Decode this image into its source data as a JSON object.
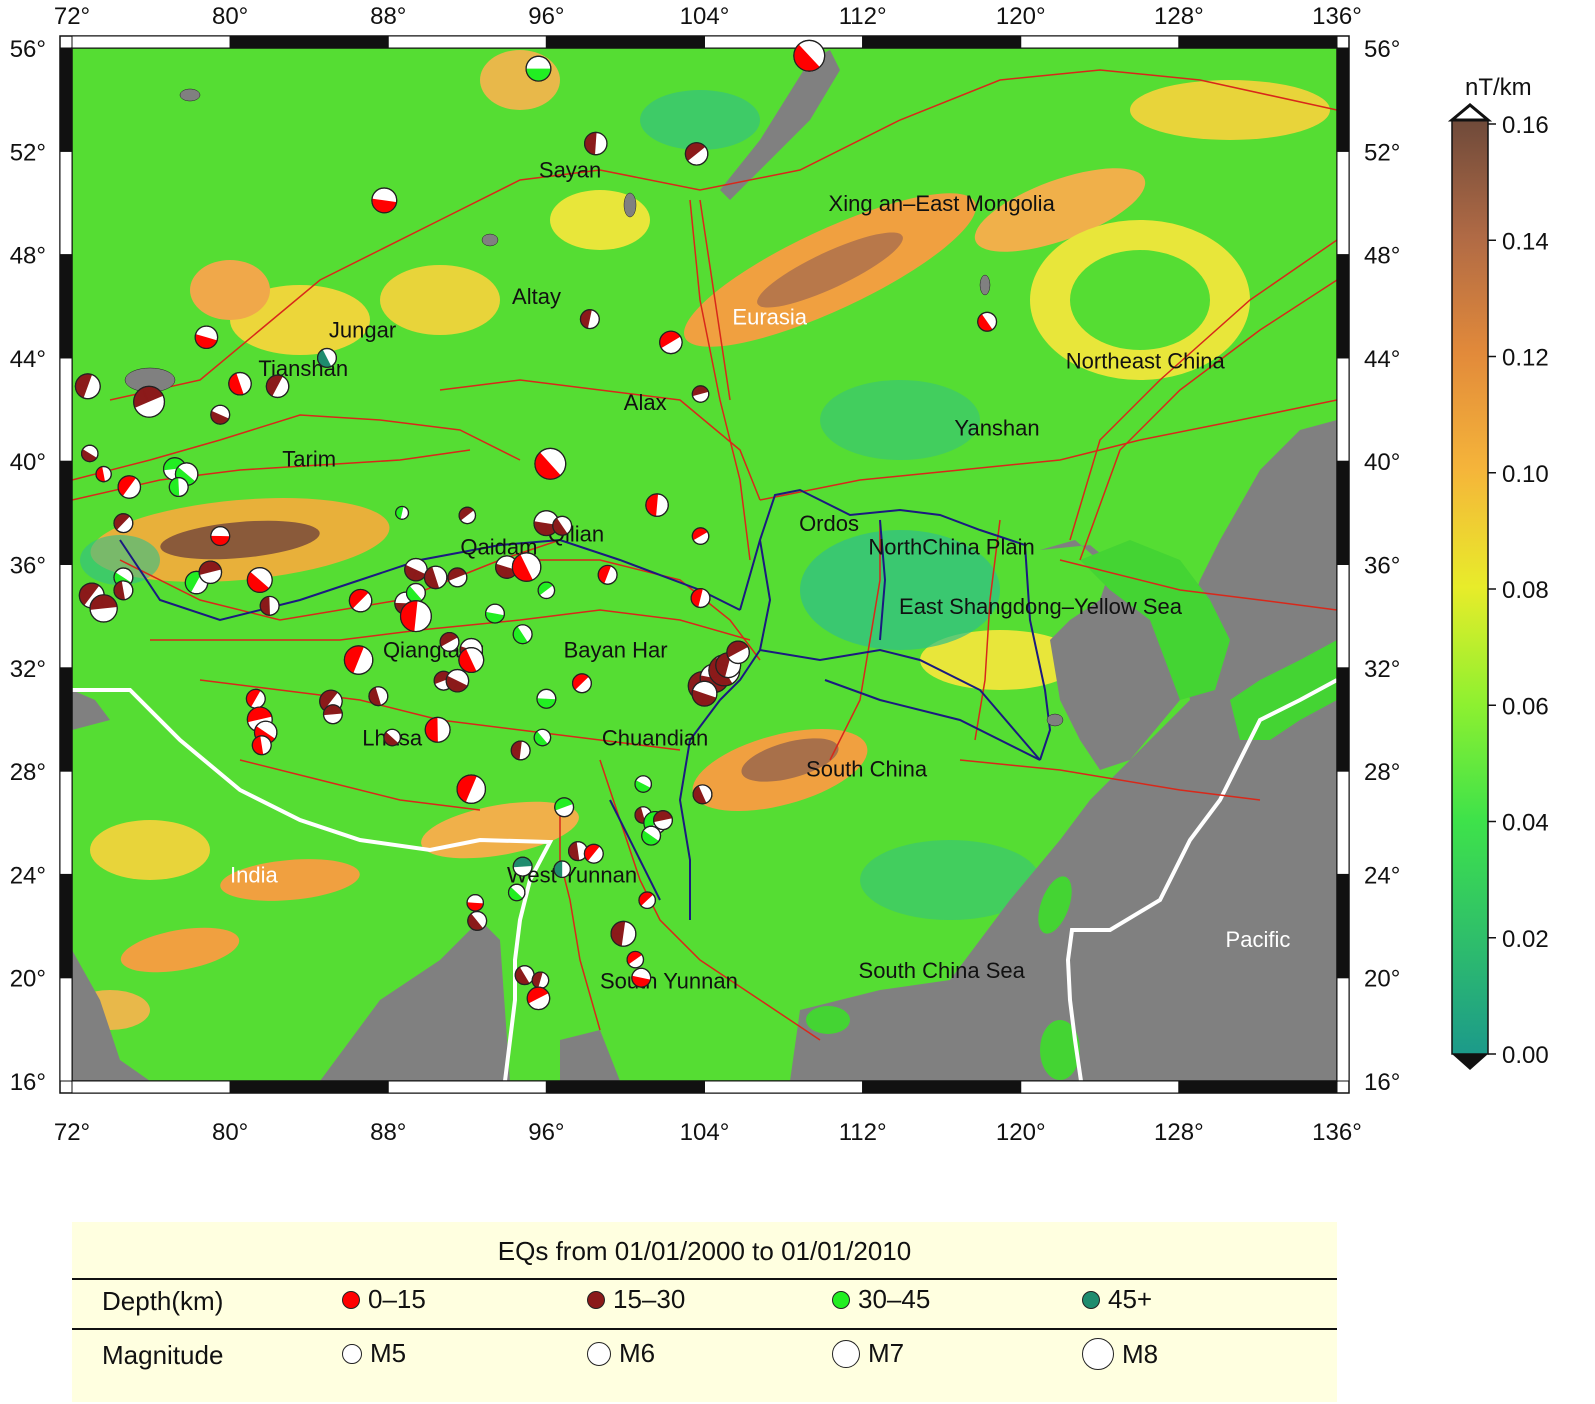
{
  "unit_label": "nT/km",
  "colorbar": {
    "ticks": [
      "0.16",
      "0.14",
      "0.12",
      "0.10",
      "0.08",
      "0.06",
      "0.04",
      "0.02",
      "0.00"
    ],
    "colors": [
      "#1c9a8a",
      "#2fbf6a",
      "#3ee24a",
      "#8ef030",
      "#e8ec2a",
      "#f5b53a",
      "#e28a3a",
      "#b06a45",
      "#6f4a3a"
    ]
  },
  "axes": {
    "lon_labels": [
      "72°",
      "80°",
      "88°",
      "96°",
      "104°",
      "112°",
      "120°",
      "128°",
      "136°"
    ],
    "lat_labels": [
      "56°",
      "52°",
      "48°",
      "44°",
      "40°",
      "36°",
      "32°",
      "28°",
      "24°",
      "20°",
      "16°"
    ]
  },
  "regions": [
    {
      "name": "Sayan",
      "lon": 97.2,
      "lat": 51.3,
      "color": "#111"
    },
    {
      "name": "Xing an–East Mongolia",
      "lon": 116,
      "lat": 50,
      "color": "#111"
    },
    {
      "name": "Altay",
      "lon": 95.5,
      "lat": 46.4,
      "color": "#111"
    },
    {
      "name": "Eurasia",
      "lon": 107.3,
      "lat": 45.6,
      "color": "#ffffff"
    },
    {
      "name": "Jungar",
      "lon": 86.7,
      "lat": 45.1,
      "color": "#111"
    },
    {
      "name": "Tianshan",
      "lon": 83.7,
      "lat": 43.6,
      "color": "#111"
    },
    {
      "name": "Northeast China",
      "lon": 126.3,
      "lat": 43.9,
      "color": "#111"
    },
    {
      "name": "Alax",
      "lon": 101,
      "lat": 42.3,
      "color": "#111"
    },
    {
      "name": "Yanshan",
      "lon": 118.8,
      "lat": 41.3,
      "color": "#111"
    },
    {
      "name": "Tarim",
      "lon": 84,
      "lat": 40.1,
      "color": "#111"
    },
    {
      "name": "Ordos",
      "lon": 110.3,
      "lat": 37.6,
      "color": "#111"
    },
    {
      "name": "Qilian",
      "lon": 97.5,
      "lat": 37.2,
      "color": "#111"
    },
    {
      "name": "Qaidam",
      "lon": 93.6,
      "lat": 36.7,
      "color": "#111"
    },
    {
      "name": "NorthChina Plain",
      "lon": 116.5,
      "lat": 36.7,
      "color": "#111"
    },
    {
      "name": "East Shangdong–Yellow Sea",
      "lon": 121,
      "lat": 34.4,
      "color": "#111"
    },
    {
      "name": "Qiangtang",
      "lon": 90.3,
      "lat": 32.7,
      "color": "#111"
    },
    {
      "name": "Bayan Har",
      "lon": 99.5,
      "lat": 32.7,
      "color": "#111"
    },
    {
      "name": "Lhasa",
      "lon": 88.2,
      "lat": 29.3,
      "color": "#111"
    },
    {
      "name": "Chuandian",
      "lon": 101.5,
      "lat": 29.3,
      "color": "#111"
    },
    {
      "name": "South China",
      "lon": 112.2,
      "lat": 28.1,
      "color": "#111"
    },
    {
      "name": "India",
      "lon": 81.2,
      "lat": 24,
      "color": "#ffffff"
    },
    {
      "name": "West Yunnan",
      "lon": 97.3,
      "lat": 24,
      "color": "#111"
    },
    {
      "name": "Pacific",
      "lon": 132,
      "lat": 21.5,
      "color": "#ffffff"
    },
    {
      "name": "South China Sea",
      "lon": 116,
      "lat": 20.3,
      "color": "#111"
    },
    {
      "name": "South Yunnan",
      "lon": 102.2,
      "lat": 19.9,
      "color": "#111"
    }
  ],
  "earthquakes": [
    {
      "lon": 95.6,
      "lat": 55.2,
      "depth": "30-45",
      "mag": 6.0
    },
    {
      "lon": 109.3,
      "lat": 55.7,
      "depth": "0-15",
      "mag": 6.5
    },
    {
      "lon": 98.5,
      "lat": 52.3,
      "depth": "15-30",
      "mag": 5.8
    },
    {
      "lon": 103.6,
      "lat": 51.9,
      "depth": "15-30",
      "mag": 5.8
    },
    {
      "lon": 87.8,
      "lat": 50.1,
      "depth": "0-15",
      "mag": 6.0
    },
    {
      "lon": 118.3,
      "lat": 45.4,
      "depth": "0-15",
      "mag": 5.5
    },
    {
      "lon": 98.2,
      "lat": 45.5,
      "depth": "15-30",
      "mag": 5.5
    },
    {
      "lon": 102.3,
      "lat": 44.6,
      "depth": "0-15",
      "mag": 5.8
    },
    {
      "lon": 78.8,
      "lat": 44.8,
      "depth": "0-15",
      "mag": 5.8
    },
    {
      "lon": 84.9,
      "lat": 44.0,
      "depth": "45+",
      "mag": 5.5
    },
    {
      "lon": 72.8,
      "lat": 42.9,
      "depth": "15-30",
      "mag": 6.0
    },
    {
      "lon": 75.9,
      "lat": 42.3,
      "depth": "15-30",
      "mag": 6.5
    },
    {
      "lon": 79.5,
      "lat": 41.8,
      "depth": "15-30",
      "mag": 5.5
    },
    {
      "lon": 80.5,
      "lat": 43.0,
      "depth": "0-15",
      "mag": 5.8
    },
    {
      "lon": 82.4,
      "lat": 42.9,
      "depth": "15-30",
      "mag": 5.8
    },
    {
      "lon": 103.8,
      "lat": 42.6,
      "depth": "15-30",
      "mag": 5.3
    },
    {
      "lon": 72.9,
      "lat": 40.3,
      "depth": "15-30",
      "mag": 5.3
    },
    {
      "lon": 73.6,
      "lat": 39.5,
      "depth": "0-15",
      "mag": 5.2
    },
    {
      "lon": 74.9,
      "lat": 39.0,
      "depth": "0-15",
      "mag": 5.8
    },
    {
      "lon": 77.2,
      "lat": 39.7,
      "depth": "30-45",
      "mag": 5.8
    },
    {
      "lon": 77.8,
      "lat": 39.5,
      "depth": "30-45",
      "mag": 5.8
    },
    {
      "lon": 77.4,
      "lat": 39.0,
      "depth": "30-45",
      "mag": 5.5
    },
    {
      "lon": 74.6,
      "lat": 37.6,
      "depth": "15-30",
      "mag": 5.5
    },
    {
      "lon": 79.5,
      "lat": 37.1,
      "depth": "0-15",
      "mag": 5.5
    },
    {
      "lon": 96.2,
      "lat": 39.9,
      "depth": "0-15",
      "mag": 6.5
    },
    {
      "lon": 101.6,
      "lat": 38.3,
      "depth": "0-15",
      "mag": 5.8
    },
    {
      "lon": 92.0,
      "lat": 37.9,
      "depth": "15-30",
      "mag": 5.3
    },
    {
      "lon": 96.0,
      "lat": 37.6,
      "depth": "15-30",
      "mag": 6.0
    },
    {
      "lon": 96.8,
      "lat": 37.5,
      "depth": "15-30",
      "mag": 5.5
    },
    {
      "lon": 88.7,
      "lat": 38.0,
      "depth": "30-45",
      "mag": 5.0
    },
    {
      "lon": 103.8,
      "lat": 37.1,
      "depth": "0-15",
      "mag": 5.3
    },
    {
      "lon": 94.0,
      "lat": 35.9,
      "depth": "15-30",
      "mag": 5.8
    },
    {
      "lon": 95.0,
      "lat": 35.9,
      "depth": "0-15",
      "mag": 6.3
    },
    {
      "lon": 99.1,
      "lat": 35.6,
      "depth": "0-15",
      "mag": 5.5
    },
    {
      "lon": 91.5,
      "lat": 35.5,
      "depth": "15-30",
      "mag": 5.5
    },
    {
      "lon": 89.4,
      "lat": 35.8,
      "depth": "15-30",
      "mag": 5.8
    },
    {
      "lon": 90.4,
      "lat": 35.5,
      "depth": "15-30",
      "mag": 5.8
    },
    {
      "lon": 78.3,
      "lat": 35.3,
      "depth": "30-45",
      "mag": 5.8
    },
    {
      "lon": 79.0,
      "lat": 35.7,
      "depth": "15-30",
      "mag": 5.8
    },
    {
      "lon": 74.6,
      "lat": 35.5,
      "depth": "30-45",
      "mag": 5.5
    },
    {
      "lon": 74.6,
      "lat": 35.0,
      "depth": "15-30",
      "mag": 5.5
    },
    {
      "lon": 73.0,
      "lat": 34.8,
      "depth": "15-30",
      "mag": 6.0
    },
    {
      "lon": 73.6,
      "lat": 34.3,
      "depth": "15-30",
      "mag": 6.2
    },
    {
      "lon": 81.5,
      "lat": 35.4,
      "depth": "0-15",
      "mag": 6.0
    },
    {
      "lon": 82.0,
      "lat": 34.4,
      "depth": "15-30",
      "mag": 5.5
    },
    {
      "lon": 86.6,
      "lat": 34.6,
      "depth": "0-15",
      "mag": 5.8
    },
    {
      "lon": 88.9,
      "lat": 34.5,
      "depth": "15-30",
      "mag": 5.8
    },
    {
      "lon": 89.4,
      "lat": 34.9,
      "depth": "30-45",
      "mag": 5.5
    },
    {
      "lon": 89.4,
      "lat": 34.0,
      "depth": "0-15",
      "mag": 6.5
    },
    {
      "lon": 96.0,
      "lat": 35.0,
      "depth": "30-45",
      "mag": 5.3
    },
    {
      "lon": 93.4,
      "lat": 34.1,
      "depth": "30-45",
      "mag": 5.5
    },
    {
      "lon": 94.8,
      "lat": 33.3,
      "depth": "30-45",
      "mag": 5.5
    },
    {
      "lon": 103.8,
      "lat": 34.7,
      "depth": "0-15",
      "mag": 5.5
    },
    {
      "lon": 91.1,
      "lat": 33.0,
      "depth": "15-30",
      "mag": 5.5
    },
    {
      "lon": 92.2,
      "lat": 32.7,
      "depth": "15-30",
      "mag": 5.8
    },
    {
      "lon": 92.2,
      "lat": 32.3,
      "depth": "0-15",
      "mag": 6.0
    },
    {
      "lon": 86.5,
      "lat": 32.3,
      "depth": "0-15",
      "mag": 6.3
    },
    {
      "lon": 90.8,
      "lat": 31.5,
      "depth": "15-30",
      "mag": 5.5
    },
    {
      "lon": 91.5,
      "lat": 31.5,
      "depth": "15-30",
      "mag": 5.8
    },
    {
      "lon": 87.5,
      "lat": 30.9,
      "depth": "15-30",
      "mag": 5.5
    },
    {
      "lon": 81.3,
      "lat": 30.8,
      "depth": "0-15",
      "mag": 5.5
    },
    {
      "lon": 81.5,
      "lat": 30.0,
      "depth": "0-15",
      "mag": 6.0
    },
    {
      "lon": 81.8,
      "lat": 29.5,
      "depth": "0-15",
      "mag": 5.8
    },
    {
      "lon": 81.6,
      "lat": 29.0,
      "depth": "0-15",
      "mag": 5.5
    },
    {
      "lon": 85.1,
      "lat": 30.7,
      "depth": "15-30",
      "mag": 5.8
    },
    {
      "lon": 85.2,
      "lat": 30.2,
      "depth": "15-30",
      "mag": 5.5
    },
    {
      "lon": 88.2,
      "lat": 29.3,
      "depth": "15-30",
      "mag": 5.3
    },
    {
      "lon": 90.5,
      "lat": 29.6,
      "depth": "0-15",
      "mag": 6.0
    },
    {
      "lon": 97.8,
      "lat": 31.4,
      "depth": "0-15",
      "mag": 5.5
    },
    {
      "lon": 96.0,
      "lat": 30.8,
      "depth": "30-45",
      "mag": 5.5
    },
    {
      "lon": 95.8,
      "lat": 29.3,
      "depth": "30-45",
      "mag": 5.3
    },
    {
      "lon": 94.7,
      "lat": 28.8,
      "depth": "15-30",
      "mag": 5.5
    },
    {
      "lon": 103.9,
      "lat": 31.3,
      "depth": "15-30",
      "mag": 6.3
    },
    {
      "lon": 104.5,
      "lat": 31.6,
      "depth": "15-30",
      "mag": 6.3
    },
    {
      "lon": 105.0,
      "lat": 31.9,
      "depth": "15-30",
      "mag": 6.5
    },
    {
      "lon": 105.2,
      "lat": 32.1,
      "depth": "15-30",
      "mag": 6.0
    },
    {
      "lon": 105.7,
      "lat": 32.6,
      "depth": "15-30",
      "mag": 5.8
    },
    {
      "lon": 104.0,
      "lat": 31.0,
      "depth": "15-30",
      "mag": 6.0
    },
    {
      "lon": 103.9,
      "lat": 27.1,
      "depth": "15-30",
      "mag": 5.5
    },
    {
      "lon": 92.2,
      "lat": 27.3,
      "depth": "0-15",
      "mag": 6.3
    },
    {
      "lon": 96.9,
      "lat": 26.6,
      "depth": "30-45",
      "mag": 5.5
    },
    {
      "lon": 100.9,
      "lat": 27.5,
      "depth": "30-45",
      "mag": 5.3
    },
    {
      "lon": 100.9,
      "lat": 26.3,
      "depth": "15-30",
      "mag": 5.3
    },
    {
      "lon": 101.5,
      "lat": 26.0,
      "depth": "30-45",
      "mag": 5.8
    },
    {
      "lon": 101.9,
      "lat": 26.1,
      "depth": "15-30",
      "mag": 5.5
    },
    {
      "lon": 101.3,
      "lat": 25.5,
      "depth": "30-45",
      "mag": 5.5
    },
    {
      "lon": 97.6,
      "lat": 24.9,
      "depth": "15-30",
      "mag": 5.5
    },
    {
      "lon": 98.4,
      "lat": 24.8,
      "depth": "0-15",
      "mag": 5.5
    },
    {
      "lon": 94.8,
      "lat": 24.3,
      "depth": "45+",
      "mag": 5.5
    },
    {
      "lon": 94.5,
      "lat": 23.3,
      "depth": "30-45",
      "mag": 5.3
    },
    {
      "lon": 96.8,
      "lat": 24.2,
      "depth": "45+",
      "mag": 5.3
    },
    {
      "lon": 101.1,
      "lat": 23.0,
      "depth": "0-15",
      "mag": 5.3
    },
    {
      "lon": 92.4,
      "lat": 22.9,
      "depth": "0-15",
      "mag": 5.3
    },
    {
      "lon": 92.5,
      "lat": 22.2,
      "depth": "15-30",
      "mag": 5.5
    },
    {
      "lon": 99.9,
      "lat": 21.7,
      "depth": "15-30",
      "mag": 6.0
    },
    {
      "lon": 100.5,
      "lat": 20.7,
      "depth": "0-15",
      "mag": 5.3
    },
    {
      "lon": 100.8,
      "lat": 20.0,
      "depth": "0-15",
      "mag": 5.5
    },
    {
      "lon": 94.9,
      "lat": 20.1,
      "depth": "15-30",
      "mag": 5.5
    },
    {
      "lon": 95.7,
      "lat": 19.9,
      "depth": "15-30",
      "mag": 5.3
    },
    {
      "lon": 95.6,
      "lat": 19.2,
      "depth": "0-15",
      "mag": 5.8
    }
  ],
  "legend": {
    "title": "EQs from 01/01/2000 to 01/01/2010",
    "depth_label": "Depth(km)",
    "depth_items": [
      {
        "label": "0–15",
        "color": "#ff0000"
      },
      {
        "label": "15–30",
        "color": "#8b1a1a"
      },
      {
        "label": "30–45",
        "color": "#22ee22"
      },
      {
        "label": "45+",
        "color": "#1e8c6e"
      }
    ],
    "magnitude_label": "Magnitude",
    "magnitude_items": [
      {
        "label": "M5",
        "size": 18
      },
      {
        "label": "M6",
        "size": 22
      },
      {
        "label": "M7",
        "size": 26
      },
      {
        "label": "M8",
        "size": 30
      }
    ]
  }
}
